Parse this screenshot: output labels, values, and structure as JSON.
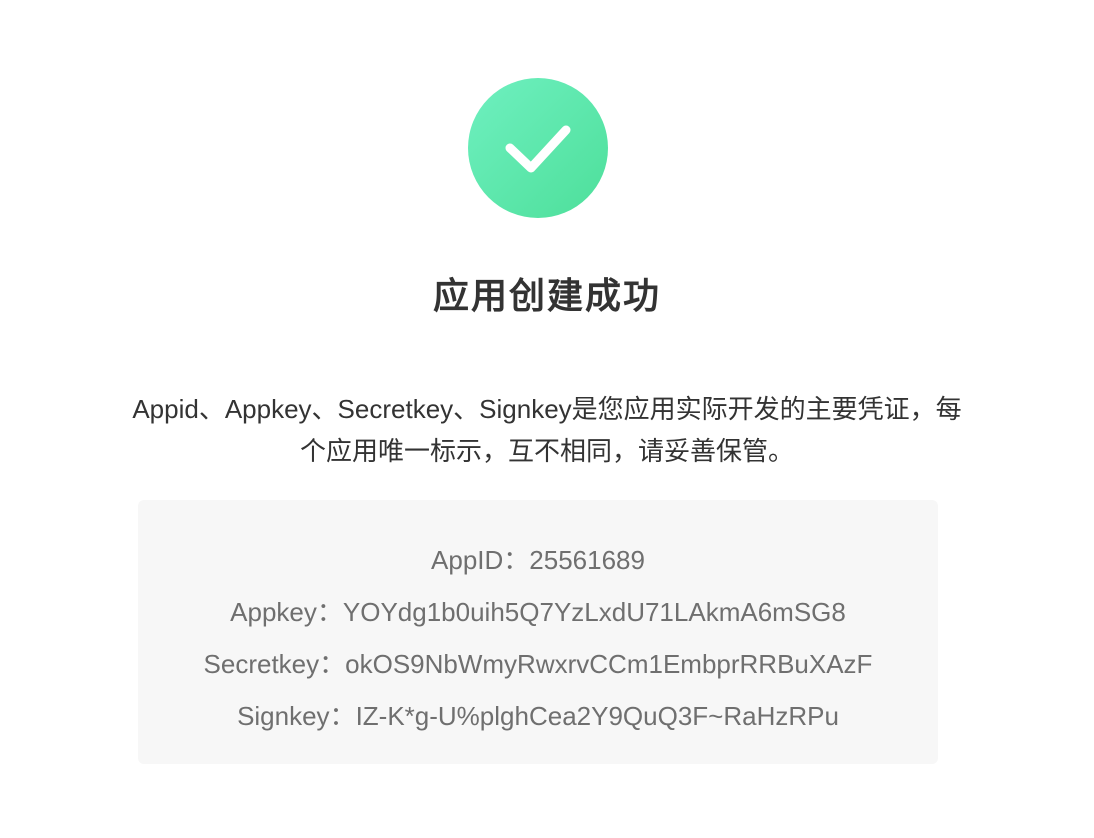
{
  "status": {
    "icon": "check-icon",
    "accent_color": "#55e3a3"
  },
  "title": "应用创建成功",
  "description": {
    "line1": "Appid、Appkey、Secretkey、Signkey是您应用实际开发的主要凭证，每",
    "line2": "个应用唯一标示，互不相同，请妥善保管。"
  },
  "credentials": {
    "appid": {
      "label": "AppID：",
      "value": "25561689"
    },
    "appkey": {
      "label": "Appkey：",
      "value": "YOYdg1b0uih5Q7YzLxdU71LAkmA6mSG8"
    },
    "secretkey": {
      "label": "Secretkey：",
      "value": "okOS9NbWmyRwxrvCCm1EmbprRRBuXAzF"
    },
    "signkey": {
      "label": "Signkey：",
      "value": "IZ-K*g-U%plghCea2Y9QuQ3F~RaHzRPu"
    }
  }
}
